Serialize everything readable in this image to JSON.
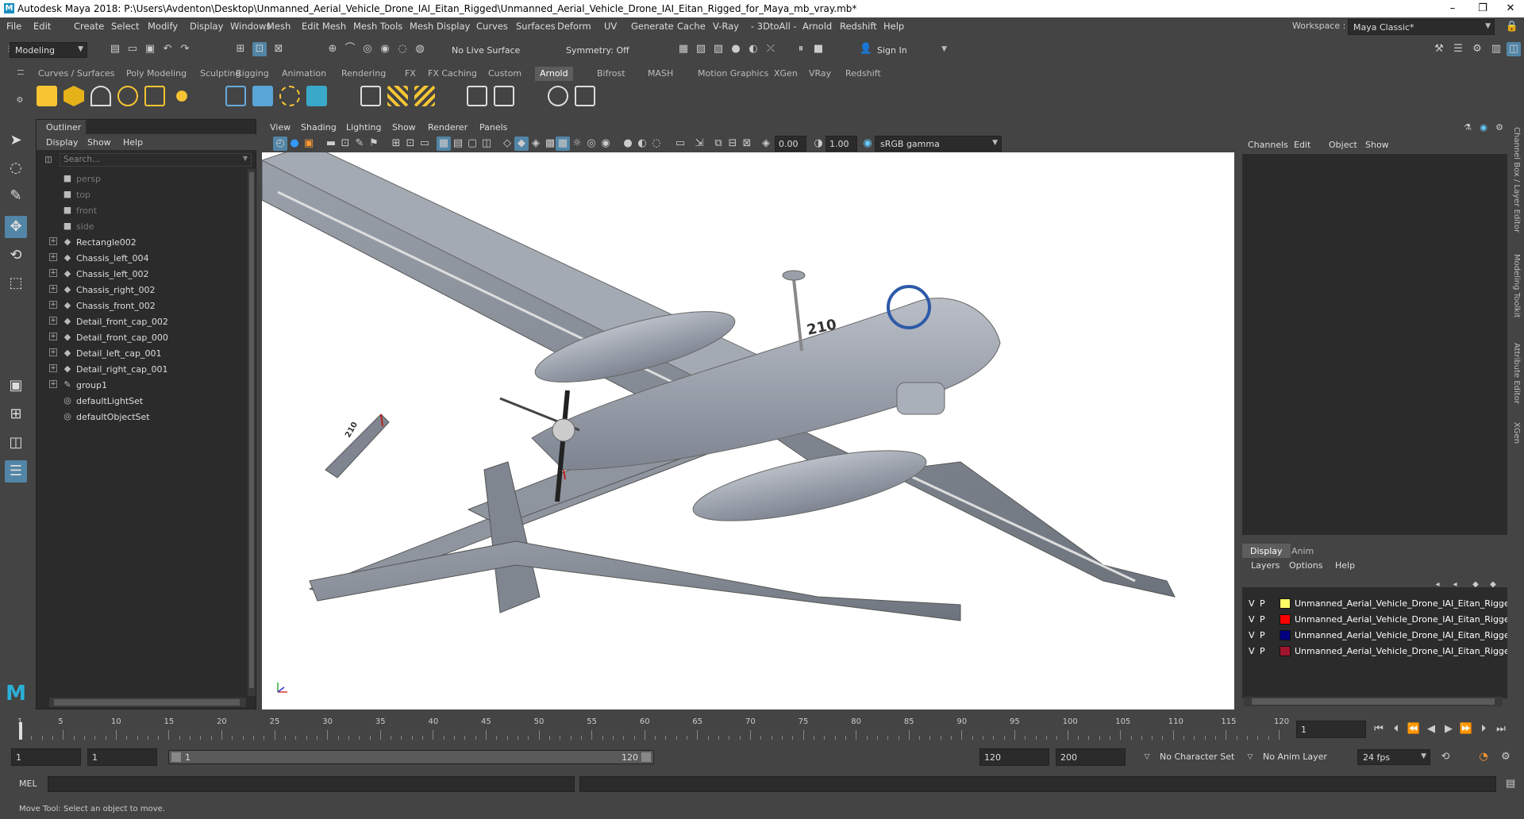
{
  "window": {
    "title": "Autodesk Maya 2018: P:\\Users\\Avdenton\\Desktop\\Unmanned_Aerial_Vehicle_Drone_IAI_Eitan_Rigged\\Unmanned_Aerial_Vehicle_Drone_IAI_Eitan_Rigged_for_Maya_mb_vray.mb*",
    "logo": "M"
  },
  "menu": [
    "File",
    "Edit",
    "Create",
    "Select",
    "Modify",
    "Display",
    "Windows",
    "Mesh",
    "Edit Mesh",
    "Mesh Tools",
    "Mesh Display",
    "Curves",
    "Surfaces",
    "Deform",
    "UV",
    "Generate",
    "Cache",
    "V-Ray",
    "- 3DtoAll -",
    "Arnold",
    "Redshift",
    "Help"
  ],
  "workspace": {
    "label": "Workspace :",
    "value": "Maya Classic*"
  },
  "toolbar": {
    "mode": "Modeling",
    "live_surface": "No Live Surface",
    "symmetry": "Symmetry: Off",
    "sign_in": "Sign In"
  },
  "shelf_tabs": [
    "Curves / Surfaces",
    "Poly Modeling",
    "Sculpting",
    "Rigging",
    "Animation",
    "Rendering",
    "FX",
    "FX Caching",
    "Custom",
    "Arnold",
    "Bifrost",
    "MASH",
    "Motion Graphics",
    "XGen",
    "VRay",
    "Redshift"
  ],
  "shelf_active": "Arnold",
  "outliner": {
    "tab": "Outliner",
    "menu": [
      "Display",
      "Show",
      "Help"
    ],
    "search_placeholder": "Search...",
    "items": [
      {
        "label": "persp",
        "dim": true,
        "icon": "camera-icon"
      },
      {
        "label": "top",
        "dim": true,
        "icon": "camera-icon"
      },
      {
        "label": "front",
        "dim": true,
        "icon": "camera-icon"
      },
      {
        "label": "side",
        "dim": true,
        "icon": "camera-icon"
      },
      {
        "label": "Rectangle002",
        "expand": true,
        "icon": "transform-icon"
      },
      {
        "label": "Chassis_left_004",
        "expand": true,
        "icon": "transform-icon"
      },
      {
        "label": "Chassis_left_002",
        "expand": true,
        "icon": "transform-icon"
      },
      {
        "label": "Chassis_right_002",
        "expand": true,
        "icon": "transform-icon"
      },
      {
        "label": "Chassis_front_002",
        "expand": true,
        "icon": "transform-icon"
      },
      {
        "label": "Detail_front_cap_002",
        "expand": true,
        "icon": "transform-icon"
      },
      {
        "label": "Detail_front_cap_000",
        "expand": true,
        "icon": "transform-icon"
      },
      {
        "label": "Detail_left_cap_001",
        "expand": true,
        "icon": "transform-icon"
      },
      {
        "label": "Detail_right_cap_001",
        "expand": true,
        "icon": "transform-icon"
      },
      {
        "label": "group1",
        "expand": true,
        "icon": "group-icon"
      },
      {
        "label": "defaultLightSet",
        "icon": "set-icon"
      },
      {
        "label": "defaultObjectSet",
        "icon": "set-icon"
      }
    ]
  },
  "viewport": {
    "menu": [
      "View",
      "Shading",
      "Lighting",
      "Show",
      "Renderer",
      "Panels"
    ],
    "exposure": "0.00",
    "gamma": "1.00",
    "color_space": "sRGB gamma",
    "drone_marking": "210",
    "tail_marking": "210"
  },
  "channel_box": {
    "menu": [
      "Channels",
      "Edit",
      "Object",
      "Show"
    ]
  },
  "layer_editor": {
    "tabs": [
      "Display",
      "Anim"
    ],
    "menu": [
      "Layers",
      "Options",
      "Help"
    ],
    "layers": [
      {
        "v": "V",
        "p": "P",
        "color": "#ffff66",
        "name": "Unmanned_Aerial_Vehicle_Drone_IAI_Eitan_Rigged_I"
      },
      {
        "v": "V",
        "p": "P",
        "color": "#ff0000",
        "name": "Unmanned_Aerial_Vehicle_Drone_IAI_Eitan_Rigged_("
      },
      {
        "v": "V",
        "p": "P",
        "color": "#000080",
        "name": "Unmanned_Aerial_Vehicle_Drone_IAI_Eitan_Rigged_I"
      },
      {
        "v": "V",
        "p": "P",
        "color": "#a0142e",
        "name": "Unmanned_Aerial_Vehicle_Drone_IAI_Eitan_Rigged_("
      }
    ]
  },
  "right_vtabs": [
    "Channel Box / Layer Editor",
    "Modeling Toolkit",
    "Attribute Editor",
    "XGen"
  ],
  "timeline": {
    "ticks": [
      "5",
      "10",
      "15",
      "20",
      "25",
      "30",
      "35",
      "40",
      "45",
      "50",
      "55",
      "60",
      "65",
      "70",
      "75",
      "80",
      "85",
      "90",
      "95",
      "100",
      "105",
      "110",
      "115",
      "120"
    ],
    "current_frame": "1",
    "start_tick": "1"
  },
  "range": {
    "start": "1",
    "playback_start": "1",
    "range_start": "1",
    "range_end": "120",
    "playback_end": "120",
    "end": "200",
    "character_set": "No Character Set",
    "anim_layer": "No Anim Layer",
    "fps": "24 fps"
  },
  "command": {
    "label": "MEL"
  },
  "help_line": "Move Tool: Select an object to move."
}
